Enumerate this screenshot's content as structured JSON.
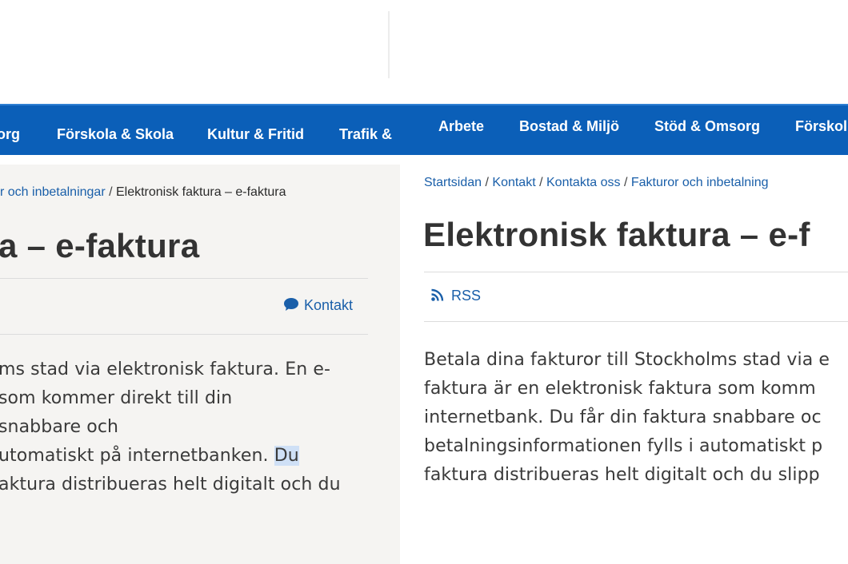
{
  "left_panel": {
    "nav": [
      "org",
      "Förskola & Skola",
      "Kultur & Fritid",
      "Trafik &"
    ],
    "breadcrumb": {
      "link": "r och inbetalningar",
      "separator": " / ",
      "current": "Elektronisk faktura – e-faktura"
    },
    "title": "a – e-faktura",
    "contact_label": "Kontakt",
    "paragraph": {
      "line1": "ms stad via elektronisk faktura. En e-",
      "line2": "som kommer direkt till din",
      "line3": "snabbare och",
      "line4_before": "utomatiskt på internetbanken. ",
      "line4_highlight": "Du",
      "line5": "aktura distribueras helt digitalt och du"
    }
  },
  "right_panel": {
    "nav": [
      "Arbete",
      "Bostad & Miljö",
      "Stöd & Omsorg",
      "Förskol"
    ],
    "breadcrumb": [
      "Startsidan",
      "Kontakt",
      "Kontakta oss",
      "Fakturor och inbetalning"
    ],
    "breadcrumb_separator": " / ",
    "title": "Elektronisk faktura – e-f",
    "rss_label": "RSS",
    "paragraph": [
      "Betala dina fakturor till Stockholms stad via e",
      "faktura är en elektronisk faktura som komm",
      "internetbank. Du får din faktura snabbare oc",
      "betalningsinformationen fylls i automatiskt p",
      "faktura distribueras helt digitalt och du slipp"
    ]
  },
  "colors": {
    "nav_background": "#0b5fb8",
    "link": "#1a5fa9",
    "text": "#3a3a3a",
    "highlight": "#cfe0f6"
  },
  "icons": {
    "contact": "speech-bubble-icon",
    "rss": "rss-icon"
  }
}
